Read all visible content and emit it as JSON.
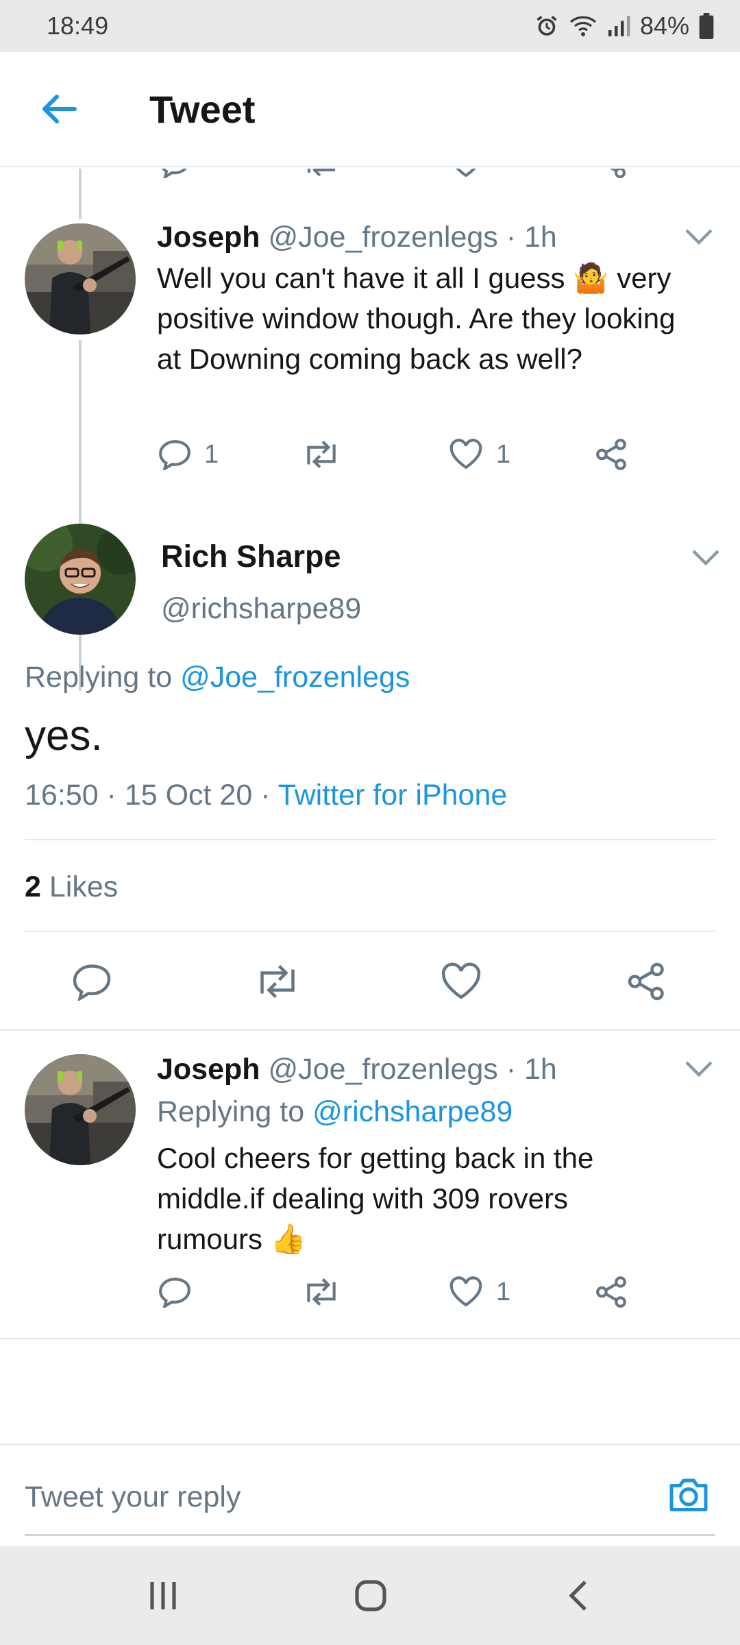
{
  "status_bar": {
    "time": "18:49",
    "battery": "84%"
  },
  "header": {
    "title": "Tweet"
  },
  "tweets": [
    {
      "name": "Joseph",
      "handle": "@Joe_frozenlegs",
      "time": "· 1h",
      "text_line1": "Well you can't have it all I guess",
      "text_emoji": "🤷",
      "text_line1_end": "very",
      "text_rest": "positive window though. Are they looking at Downing coming back as well?",
      "reply_count": "1",
      "retweet_count": "",
      "like_count": "1"
    },
    {
      "name": "Joseph",
      "handle": "@Joe_frozenlegs",
      "time": "· 1h",
      "replying_prefix": "Replying to",
      "replying_to": "@richsharpe89",
      "text": "Cool cheers for getting back in the middle.if dealing with 309 rovers rumours",
      "text_emoji": "👍",
      "reply_count": "",
      "retweet_count": "",
      "like_count": "1"
    }
  ],
  "main_tweet": {
    "name": "Rich Sharpe",
    "handle": "@richsharpe89",
    "replying_prefix": "Replying to",
    "replying_to": "@Joe_frozenlegs",
    "text": "yes.",
    "timestamp": "16:50 · 15 Oct 20 ·",
    "source": "Twitter for iPhone",
    "likes_count": "2",
    "likes_label": "Likes"
  },
  "reply_bar": {
    "placeholder": "Tweet your reply"
  },
  "icons": {
    "back": "arrow-left-icon",
    "reply": "speech-bubble-icon",
    "retweet": "retweet-icon",
    "like": "heart-icon",
    "share": "share-icon",
    "more": "chevron-down-icon",
    "camera": "camera-icon"
  },
  "colors": {
    "accent": "#1b95e0",
    "secondary_text": "#657786",
    "primary_text": "#14171a"
  }
}
